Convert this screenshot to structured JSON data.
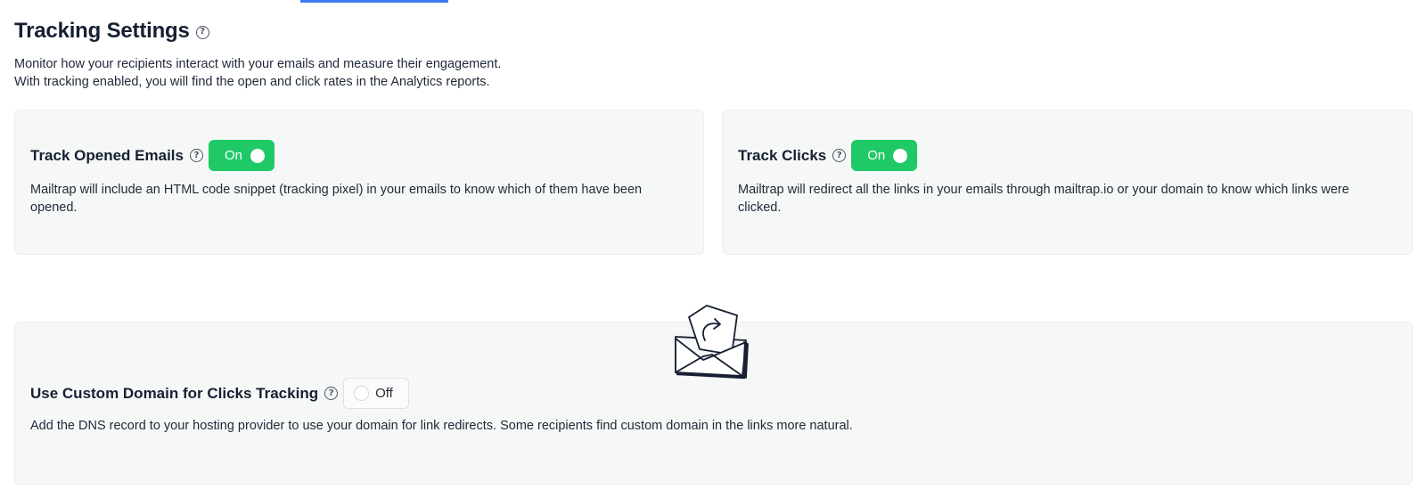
{
  "header": {
    "title": "Tracking Settings",
    "help_glyph": "?",
    "description_line1": "Monitor how your recipients interact with your emails and measure their engagement.",
    "description_line2": "With tracking enabled, you will find the open and click rates in the Analytics reports."
  },
  "cards": {
    "opened": {
      "title": "Track Opened Emails",
      "toggle_label": "On",
      "toggle_state": "on",
      "description": "Mailtrap will include an HTML code snippet (tracking pixel) in your emails to know which of them have been opened."
    },
    "clicks": {
      "title": "Track Clicks",
      "toggle_label": "On",
      "toggle_state": "on",
      "description": "Mailtrap will redirect all the links in your emails through mailtrap.io or your domain to know which links were clicked."
    },
    "custom_domain": {
      "title": "Use Custom Domain for Clicks Tracking",
      "toggle_label": "Off",
      "toggle_state": "off",
      "description": "Add the DNS record to your hosting provider to use your domain for link redirects. Some recipients find custom domain in the links more natural."
    }
  },
  "icons": {
    "help": "help-circle-icon",
    "illustration": "envelope-redirect-illustration"
  },
  "colors": {
    "toggle_on": "#1fca66",
    "tab_indicator": "#3f7bf0",
    "card_bg": "#f6f8f8",
    "text_primary": "#162032"
  }
}
